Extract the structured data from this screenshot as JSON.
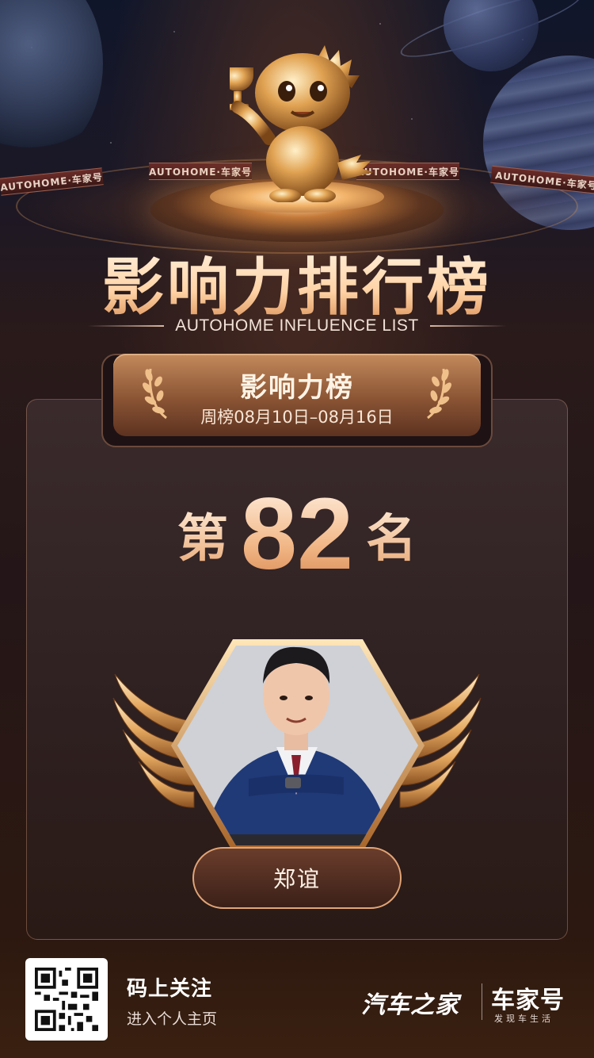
{
  "header": {
    "ring_labels": [
      "AUTOHOME·车家号",
      "AUTOHOME·车家号",
      "AUTOHOME·车家号",
      "AUTOHOME·车家号"
    ],
    "title": "影响力排行榜",
    "subtitle": "AUTOHOME INFLUENCE LIST"
  },
  "banner": {
    "title": "影响力榜",
    "period": "周榜08月10日–08月16日"
  },
  "rank": {
    "prefix": "第",
    "number": "82",
    "suffix": "名"
  },
  "profile": {
    "name": "郑谊"
  },
  "footer": {
    "follow_title": "码上关注",
    "follow_sub": "进入个人主页",
    "brand_main": "汽车之家",
    "brand_secondary": "车家号",
    "brand_secondary_tagline": "发现车生活"
  },
  "colors": {
    "accent_gold": "#f2b888",
    "card_bg": "#2e2020",
    "pill_border": "#e2a577"
  }
}
